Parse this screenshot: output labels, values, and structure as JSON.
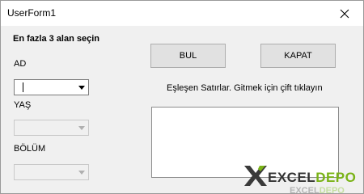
{
  "window": {
    "title": "UserForm1",
    "close_glyph": "close-icon"
  },
  "form": {
    "heading": "En fazla 3 alan seçin",
    "fields": [
      {
        "label": "AD",
        "value": "",
        "enabled": true
      },
      {
        "label": "YAŞ",
        "value": "",
        "enabled": false
      },
      {
        "label": "BÖLÜM",
        "value": "",
        "enabled": false
      }
    ],
    "buttons": {
      "find_label": "BUL",
      "close_label": "KAPAT"
    },
    "results_hint": "Eşleşen Satırlar. Gitmek için çift tıklayın",
    "results": []
  },
  "watermark": {
    "brand": "EXCELDEPO",
    "colors": {
      "x": "#3a3a3a",
      "text": "#333333",
      "accent": "#7ab317"
    }
  }
}
